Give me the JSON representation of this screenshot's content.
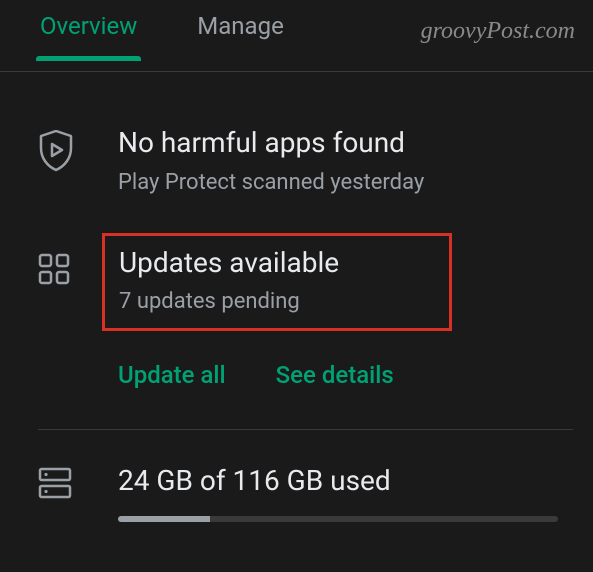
{
  "watermark": "groovyPost.com",
  "tabs": {
    "overview": "Overview",
    "manage": "Manage"
  },
  "protect": {
    "title": "No harmful apps found",
    "subtitle": "Play Protect scanned yesterday"
  },
  "updates": {
    "title": "Updates available",
    "subtitle": "7 updates pending",
    "update_all": "Update all",
    "see_details": "See details"
  },
  "storage": {
    "text": "24 GB of 116 GB used",
    "percent": 21
  }
}
